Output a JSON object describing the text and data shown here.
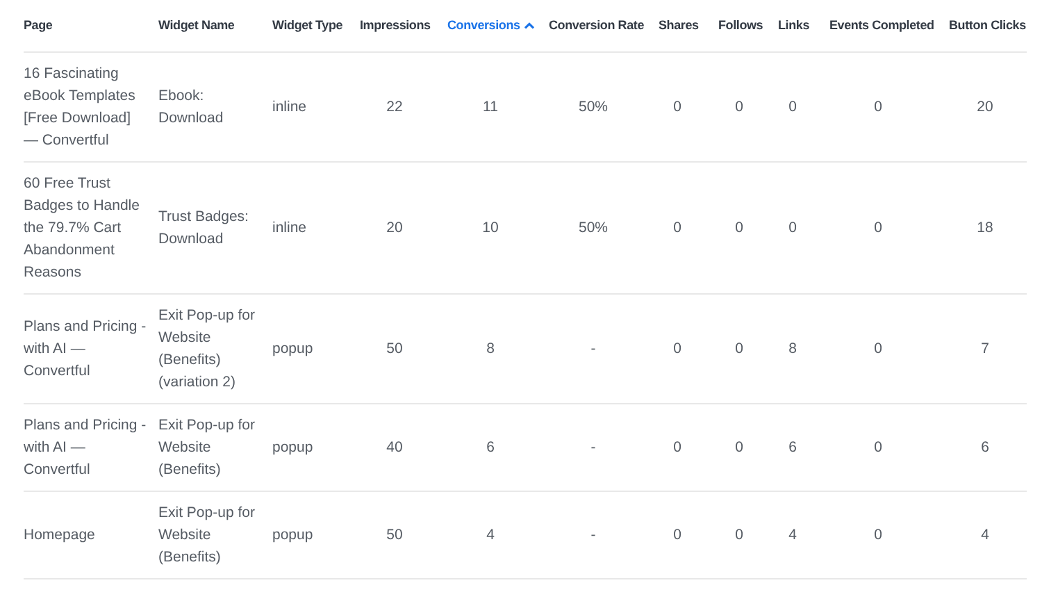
{
  "table": {
    "columns": [
      {
        "label": "Page",
        "sorted": false
      },
      {
        "label": "Widget Name",
        "sorted": false
      },
      {
        "label": "Widget Type",
        "sorted": false
      },
      {
        "label": "Impressions",
        "sorted": false
      },
      {
        "label": "Conversions",
        "sorted": true
      },
      {
        "label": "Conversion Rate",
        "sorted": false
      },
      {
        "label": "Shares",
        "sorted": false
      },
      {
        "label": "Follows",
        "sorted": false
      },
      {
        "label": "Links",
        "sorted": false
      },
      {
        "label": "Events Completed",
        "sorted": false
      },
      {
        "label": "Button Clicks",
        "sorted": false
      }
    ],
    "rows": [
      [
        "16 Fascinating eBook Templates [Free Download] — Convertful",
        "Ebook: Download",
        "inline",
        "22",
        "11",
        "50%",
        "0",
        "0",
        "0",
        "0",
        "20"
      ],
      [
        "60 Free Trust Badges to Handle the 79.7% Cart Abandonment Reasons",
        "Trust Badges: Download",
        "inline",
        "20",
        "10",
        "50%",
        "0",
        "0",
        "0",
        "0",
        "18"
      ],
      [
        "Plans and Pricing - with AI — Convertful",
        "Exit Pop-up for Website (Benefits) (variation 2)",
        "popup",
        "50",
        "8",
        "-",
        "0",
        "0",
        "8",
        "0",
        "7"
      ],
      [
        "Plans and Pricing - with AI — Convertful",
        "Exit Pop-up for Website (Benefits)",
        "popup",
        "40",
        "6",
        "-",
        "0",
        "0",
        "6",
        "0",
        "6"
      ],
      [
        "Homepage",
        "Exit Pop-up for Website (Benefits)",
        "popup",
        "50",
        "4",
        "-",
        "0",
        "0",
        "4",
        "0",
        "4"
      ]
    ]
  }
}
